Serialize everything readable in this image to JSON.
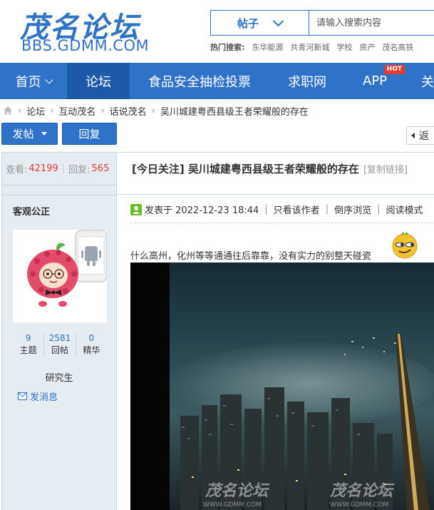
{
  "header": {
    "logo_cn": "茂名论坛",
    "logo_en": "BBS.GDMM.COM",
    "search_type": "帖子",
    "search_placeholder": "请输入搜索内容",
    "hot_label": "热门搜索:",
    "hot_terms": [
      "东华能源",
      "共青河新城",
      "学校",
      "房产",
      "茂名高铁"
    ]
  },
  "nav": {
    "items": [
      "首页",
      "论坛",
      "食品安全抽检投票",
      "求职网",
      "APP",
      "关"
    ],
    "hot_badge": "HOT"
  },
  "breadcrumb": [
    "论坛",
    "互动茂名",
    "话说茂名",
    "吴川城建粤西县级王者荣耀般的存在"
  ],
  "actions": {
    "post": "发帖",
    "reply": "回复",
    "return": "返"
  },
  "thread": {
    "views_label": "查看:",
    "views": "42199",
    "replies_label": "回复:",
    "replies": "565",
    "title": "[今日关注] 吴川城建粤西县级王者荣耀般的存在",
    "copy_link": "[复制链接]"
  },
  "author": {
    "name": "客观公正",
    "stats": [
      {
        "num": "9",
        "label": "主题"
      },
      {
        "num": "2581",
        "label": "回帖"
      },
      {
        "num": "0",
        "label": "精华"
      }
    ],
    "rank": "研究生",
    "message": "发消息"
  },
  "post": {
    "posted_at": "发表于 2022-12-23 18:44",
    "only_author": "只看该作者",
    "reverse": "倒序浏览",
    "read_mode": "阅读模式",
    "text": "什么高州，化州等等通通往后靠靠，没有实力的别整天碰瓷",
    "watermark_text": "茂名论坛",
    "watermark_url": "WWW.GDMM.COM"
  },
  "colors": {
    "brand": "#2f73c9",
    "nav_active": "#1d5ba9",
    "count_red": "#e03a3a",
    "sidebar_bg": "#e5edf2"
  }
}
